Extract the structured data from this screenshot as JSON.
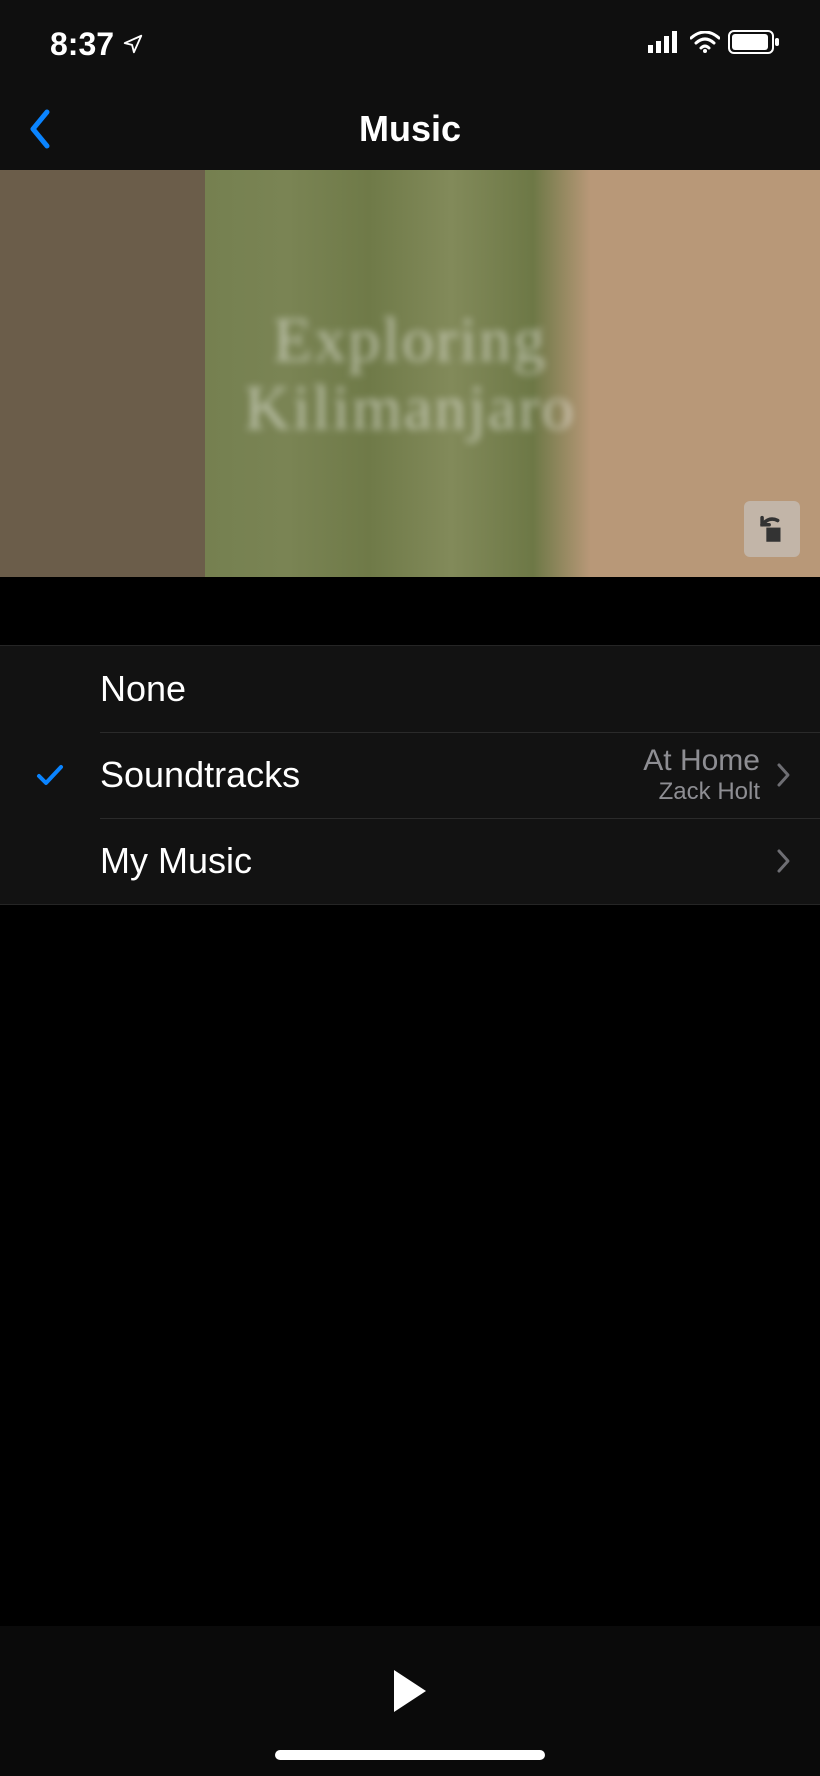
{
  "status": {
    "time": "8:37",
    "location_icon": "location-arrow"
  },
  "nav": {
    "title": "Music"
  },
  "preview": {
    "overlay_line1": "Exploring",
    "overlay_line2": "Kilimanjaro"
  },
  "list": {
    "items": [
      {
        "label": "None",
        "selected": false,
        "detail_title": "",
        "detail_subtitle": "",
        "has_chevron": false
      },
      {
        "label": "Soundtracks",
        "selected": true,
        "detail_title": "At Home",
        "detail_subtitle": "Zack Holt",
        "has_chevron": true
      },
      {
        "label": "My Music",
        "selected": false,
        "detail_title": "",
        "detail_subtitle": "",
        "has_chevron": true
      }
    ]
  }
}
